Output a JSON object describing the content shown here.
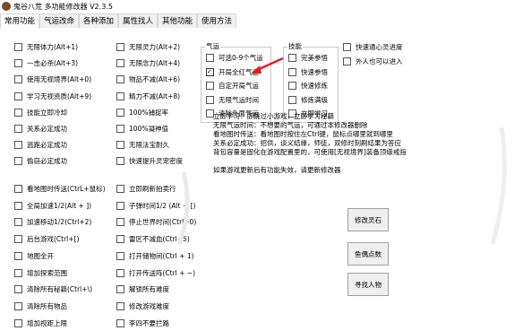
{
  "window": {
    "title": "鬼谷八荒 多功能修改器 V2.3.5"
  },
  "tabs": [
    {
      "label": "常用功能",
      "active": true
    },
    {
      "label": "气运改命",
      "active": false
    },
    {
      "label": "各种添加",
      "active": false
    },
    {
      "label": "属性找人",
      "active": false
    },
    {
      "label": "其他功能",
      "active": false
    },
    {
      "label": "使用方法",
      "active": false
    }
  ],
  "col1": [
    {
      "label": "无限体力(Alt+1)",
      "checked": false
    },
    {
      "label": "一击必杀(Alt+3)",
      "checked": false
    },
    {
      "label": "使用无视境界(Alt+0)",
      "checked": false
    },
    {
      "label": "学习无视资质(Alt+9)",
      "checked": false
    },
    {
      "label": "技能立即冷却",
      "checked": false
    },
    {
      "label": "关系必定成功",
      "checked": false
    },
    {
      "label": "逃跑必定成功",
      "checked": false
    },
    {
      "label": "偷窃必定成功",
      "checked": false
    },
    {
      "label": "看地图时传送(CtrL+鼠标)",
      "checked": false
    },
    {
      "label": "全局加速1/2(Alt + ])",
      "checked": false
    },
    {
      "label": "加速移动1/2(Ctrl+2)",
      "checked": false
    },
    {
      "label": "后台游戏(Ctrl+[)",
      "checked": false
    },
    {
      "label": "地图全开",
      "checked": false
    },
    {
      "label": "增加探索范围",
      "checked": false
    },
    {
      "label": "清除所有秘籍(Ctrl+\\)",
      "checked": false
    },
    {
      "label": "清除所有物品",
      "checked": false
    },
    {
      "label": "增加视距上限",
      "checked": false
    }
  ],
  "col2": [
    {
      "label": "无限灵力(Alt+2)",
      "checked": false
    },
    {
      "label": "无限念力(Alt+4)",
      "checked": false
    },
    {
      "label": "物品不减(Alt+6)",
      "checked": false
    },
    {
      "label": "精力不减(Alt+8)",
      "checked": false
    },
    {
      "label": "100%捕捉率",
      "checked": false
    },
    {
      "label": "100%凝神值",
      "checked": false
    },
    {
      "label": "无限法宝耐久",
      "checked": false
    },
    {
      "label": "快速提升灵宠密度",
      "checked": false
    },
    {
      "label": "立即刷新拍卖行",
      "checked": false
    },
    {
      "label": "子弹时间1/2 (Alt + [)",
      "checked": false
    },
    {
      "label": "停止世界时间(Ctrl+0)",
      "checked": false
    },
    {
      "label": "雷区不减血(Ctrl+5)",
      "checked": false
    },
    {
      "label": "打开储物间(Ctrl + 1)",
      "checked": false
    },
    {
      "label": "打开传送阵(Ctrl + ~)",
      "checked": false
    },
    {
      "label": "解锁所有难度",
      "checked": false
    },
    {
      "label": "修改游戏难度",
      "checked": false
    },
    {
      "label": "李四不要拦路",
      "checked": false
    }
  ],
  "luck": {
    "title": "气运",
    "items": [
      {
        "label": "可选0-9个气运",
        "checked": false
      },
      {
        "label": "开局全红气运",
        "checked": true
      },
      {
        "label": "自定开局气运",
        "checked": false
      },
      {
        "label": "无限气运时间",
        "checked": false
      },
      {
        "label": "清除负面气运",
        "checked": false
      }
    ]
  },
  "skill": {
    "title": "技能",
    "items": [
      {
        "label": "完美参悟",
        "checked": false
      },
      {
        "label": "快速参悟",
        "checked": false
      },
      {
        "label": "快速修炼",
        "checked": false
      },
      {
        "label": "修炼满级",
        "checked": false
      },
      {
        "label": "立即学习",
        "checked": false
      }
    ]
  },
  "extra": [
    {
      "label": "快速通心灵进度",
      "checked": false
    },
    {
      "label": "外人也可以进入",
      "checked": false
    }
  ],
  "info_lines": [
    "立即学习：即跳过小游戏，立即学习秘籍",
    "无限气运时间：不想要的气运，可通过本修改器删除",
    "看地图时传送：看地图时按住左Ctrl键，鼠标点哪里就到哪里",
    "关系必定成功：招供，谈义结缘，师徒，双修时刻刷结果为答应",
    "背包容量是固化在游戏配置里的，可使用[无视境界]装备顶级戒指",
    "",
    "如果游戏更新后有功能失效，请更新修改器"
  ],
  "buttons": [
    {
      "label": "修改灵石"
    },
    {
      "label": "鱼偶点数"
    },
    {
      "label": "寻找人物"
    }
  ]
}
